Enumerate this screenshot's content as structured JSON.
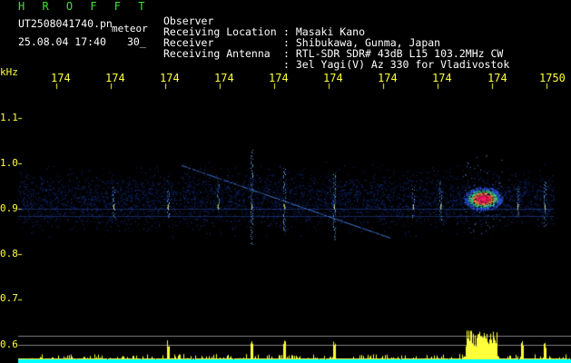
{
  "header": {
    "brand": "H R O F F T",
    "filename": "UT2508041740.pn",
    "filename_tag": "meteor",
    "timestamp": "25.08.04 17:40",
    "duration": "30_"
  },
  "info": [
    {
      "label": "Observer",
      "value": ": Masaki Kano"
    },
    {
      "label": "Receiving Location",
      "value": ": Shibukawa, Gunma, Japan"
    },
    {
      "label": "Receiver",
      "value": ": RTL-SDR SDR# 43dB L15 103.2MHz CW"
    },
    {
      "label": "Receiving Antenna",
      "value": ": 3el Yagi(V) Az 330 for Vladivostok"
    }
  ],
  "y_axis": {
    "unit": "kHz",
    "ticks": [
      "1.1",
      "1.0",
      "0.9",
      "0.8",
      "0.7",
      "0.6"
    ]
  },
  "x_axis": {
    "ticks": [
      "174",
      "174",
      "174",
      "174",
      "174",
      "174",
      "174",
      "174",
      "174",
      "1750"
    ]
  },
  "colors": {
    "brand": "#3be33b",
    "labels": "#ffffff",
    "axis": "#ffff3a",
    "background": "#000000",
    "signal_low": "#1a3cff",
    "signal_hot": "#ff2060",
    "histogram": "#ffff3a",
    "baseline": "#00ffff"
  }
}
